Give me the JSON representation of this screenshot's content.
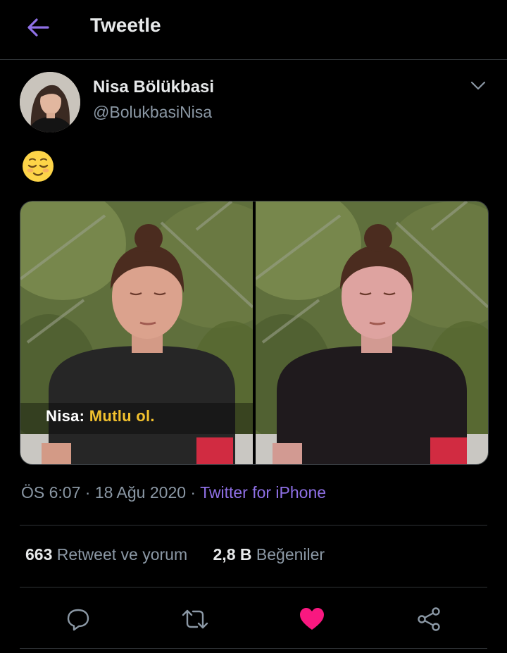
{
  "header": {
    "title": "Tweetle"
  },
  "tweet": {
    "author_name": "Nisa Bölükbasi",
    "author_handle": "@BolukbasiNisa",
    "emoji": "😌",
    "media_caption_speaker": "Nisa:",
    "media_caption_text": "Mutlu ol.",
    "time": "ÖS 6:07",
    "date": "18 Ağu 2020",
    "source": "Twitter for iPhone",
    "separator": "·"
  },
  "stats": {
    "retweets_count": "663",
    "retweets_label": "Retweet ve yorum",
    "likes_count": "2,8 B",
    "likes_label": "Beğeniler"
  },
  "colors": {
    "accent": "#8f70e6",
    "like": "#f91880",
    "background": "#000000"
  },
  "icons": [
    "back-arrow-icon",
    "chevron-down-icon",
    "reply-icon",
    "retweet-icon",
    "heart-icon",
    "share-icon"
  ]
}
